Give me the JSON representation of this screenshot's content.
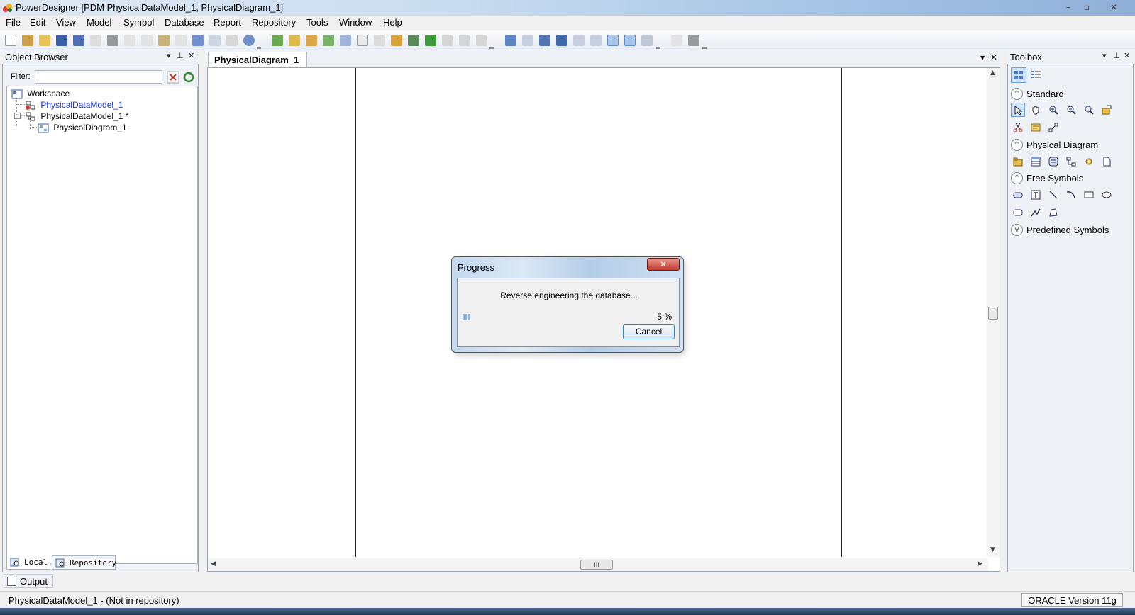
{
  "window": {
    "title": "PowerDesigner [PDM PhysicalDataModel_1, PhysicalDiagram_1]",
    "minimize": "–",
    "restore": "▫",
    "close": "✕"
  },
  "menu": [
    "File",
    "Edit",
    "View",
    "Model",
    "Symbol",
    "Database",
    "Report",
    "Repository",
    "Tools",
    "Window",
    "Help"
  ],
  "object_browser": {
    "title": "Object Browser",
    "filter_label": "Filter:",
    "filter_value": "",
    "tree": [
      {
        "label": "Workspace",
        "color": "#000000"
      },
      {
        "label": "PhysicalDataModel_1",
        "color": "#1a35c8"
      },
      {
        "label": "PhysicalDataModel_1 *",
        "color": "#000000"
      },
      {
        "label": "PhysicalDiagram_1",
        "color": "#000000"
      }
    ],
    "tabs": {
      "local": "Local",
      "repository": "Repository"
    }
  },
  "output": {
    "label": "Output"
  },
  "diagram": {
    "tab_label": "PhysicalDiagram_1",
    "scroll_thumb_glyph": "III"
  },
  "toolbox": {
    "title": "Toolbox",
    "sections": [
      {
        "label": "Standard",
        "state": "^"
      },
      {
        "label": "Physical Diagram",
        "state": "^"
      },
      {
        "label": "Free Symbols",
        "state": "^"
      },
      {
        "label": "Predefined Symbols",
        "state": "v"
      }
    ]
  },
  "status": {
    "left": "PhysicalDataModel_1 - (Not in repository)",
    "right": "ORACLE Version 11g"
  },
  "dialog": {
    "title": "Progress",
    "message": "Reverse engineering the database...",
    "percent_text": "5 %",
    "progress": 0.05,
    "cancel_label": "Cancel",
    "close_glyph": "✕"
  },
  "colors": {
    "accent": "#3c7fb1",
    "selection": "#cfe3fb",
    "link_blue": "#1a35c8"
  }
}
